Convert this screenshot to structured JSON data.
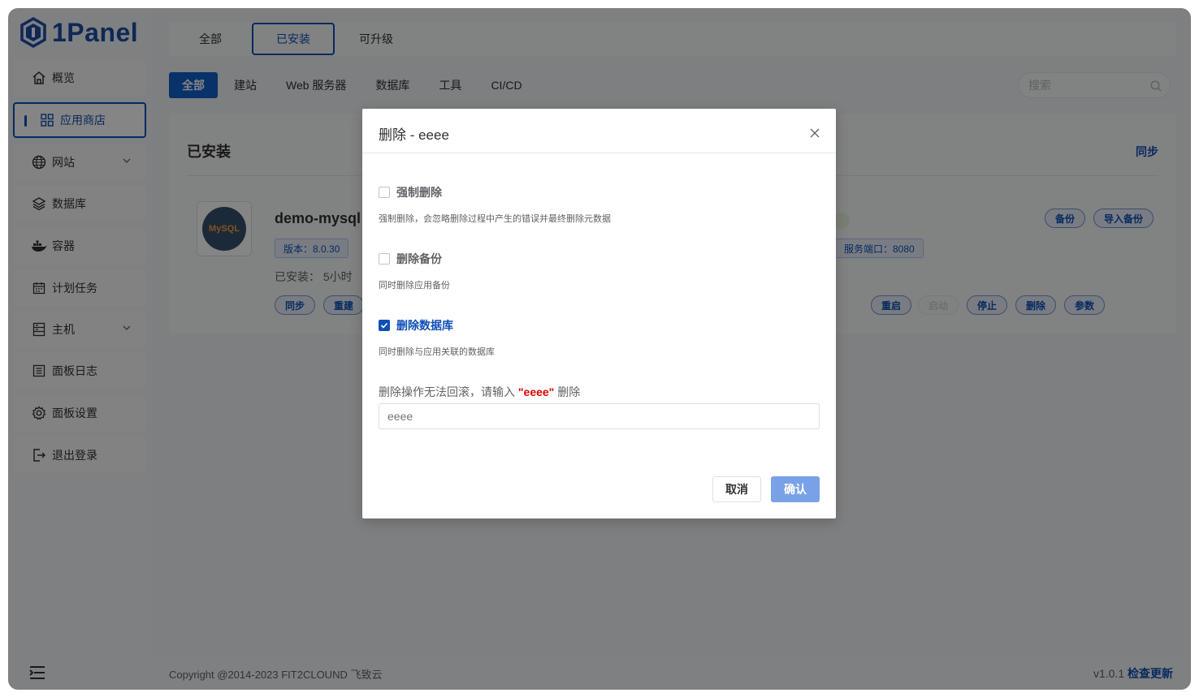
{
  "brand": {
    "name": "1Panel"
  },
  "sidebar": {
    "items": [
      {
        "label": "概览"
      },
      {
        "label": "应用商店"
      },
      {
        "label": "网站"
      },
      {
        "label": "数据库"
      },
      {
        "label": "容器"
      },
      {
        "label": "计划任务"
      },
      {
        "label": "主机"
      },
      {
        "label": "面板日志"
      },
      {
        "label": "面板设置"
      },
      {
        "label": "退出登录"
      }
    ]
  },
  "top_tabs": [
    {
      "label": "全部"
    },
    {
      "label": "已安装"
    },
    {
      "label": "可升级"
    }
  ],
  "categories": [
    {
      "label": "全部"
    },
    {
      "label": "建站"
    },
    {
      "label": "Web 服务器"
    },
    {
      "label": "数据库"
    },
    {
      "label": "工具"
    },
    {
      "label": "CI/CD"
    }
  ],
  "search": {
    "placeholder": "搜索"
  },
  "panel": {
    "title": "已安装",
    "sync_label": "同步",
    "app": {
      "logo_text": "MySQL",
      "name": "demo-mysql",
      "version_tag": "版本：8.0.30",
      "port_tag": "服务端口：8080",
      "installed": "已安装：  5小时",
      "left_actions": [
        "同步",
        "重建"
      ],
      "right_actions": [
        "重启",
        "启动",
        "停止",
        "删除",
        "参数"
      ],
      "backup_actions": [
        "备份",
        "导入备份"
      ]
    }
  },
  "footer": {
    "copyright": "Copyright @2014-2023 FIT2CLOUND 飞致云",
    "version": "v1.0.1",
    "check_update": "检查更新"
  },
  "dialog": {
    "title": "删除 - eeee",
    "options": [
      {
        "label": "强制删除",
        "hint": "强制删除，会忽略删除过程中产生的错误并最终删除元数据",
        "checked": false
      },
      {
        "label": "删除备份",
        "hint": "同时删除应用备份",
        "checked": false
      },
      {
        "label": "删除数据库",
        "hint": "同时删除与应用关联的数据库",
        "checked": true
      }
    ],
    "confirm_prefix": "删除操作无法回滚，请输入 ",
    "confirm_name": "\"eeee\"",
    "confirm_suffix": " 删除",
    "input_placeholder": "eeee",
    "cancel_label": "取消",
    "ok_label": "确认"
  }
}
